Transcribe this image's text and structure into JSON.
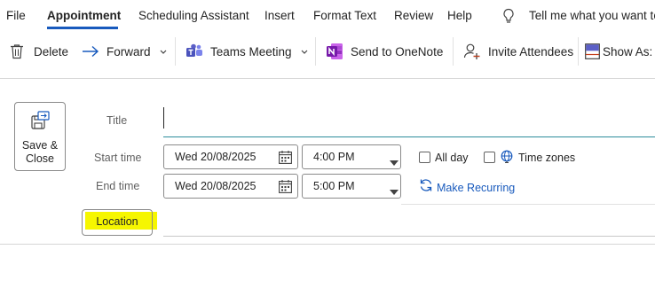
{
  "menu": {
    "tabs": [
      {
        "label": "File"
      },
      {
        "label": "Appointment"
      },
      {
        "label": "Scheduling Assistant"
      },
      {
        "label": "Insert"
      },
      {
        "label": "Format Text"
      },
      {
        "label": "Review"
      },
      {
        "label": "Help"
      }
    ],
    "active_tab": "Appointment",
    "tell_me": "Tell me what you want to"
  },
  "toolbar": {
    "delete": "Delete",
    "forward": "Forward",
    "teams_meeting": "Teams Meeting",
    "send_onenote": "Send to OneNote",
    "invite_attendees": "Invite Attendees",
    "show_as": "Show As:"
  },
  "form": {
    "save_close_line1": "Save &",
    "save_close_line2": "Close",
    "title_label": "Title",
    "title_value": "",
    "start_label": "Start time",
    "start_date": "Wed 20/08/2025",
    "start_time": "4:00 PM",
    "end_label": "End time",
    "end_date": "Wed 20/08/2025",
    "end_time": "5:00 PM",
    "all_day": "All day",
    "all_day_checked": false,
    "time_zones": "Time zones",
    "time_zones_checked": false,
    "make_recurring": "Make Recurring",
    "location_label": "Location",
    "location_value": ""
  },
  "colors": {
    "accent_blue": "#185abd",
    "teams_purple": "#5b5fc7",
    "onenote_purple": "#7719aa",
    "highlight_yellow": "#f6f600",
    "title_underline": "#2b8c9c"
  }
}
